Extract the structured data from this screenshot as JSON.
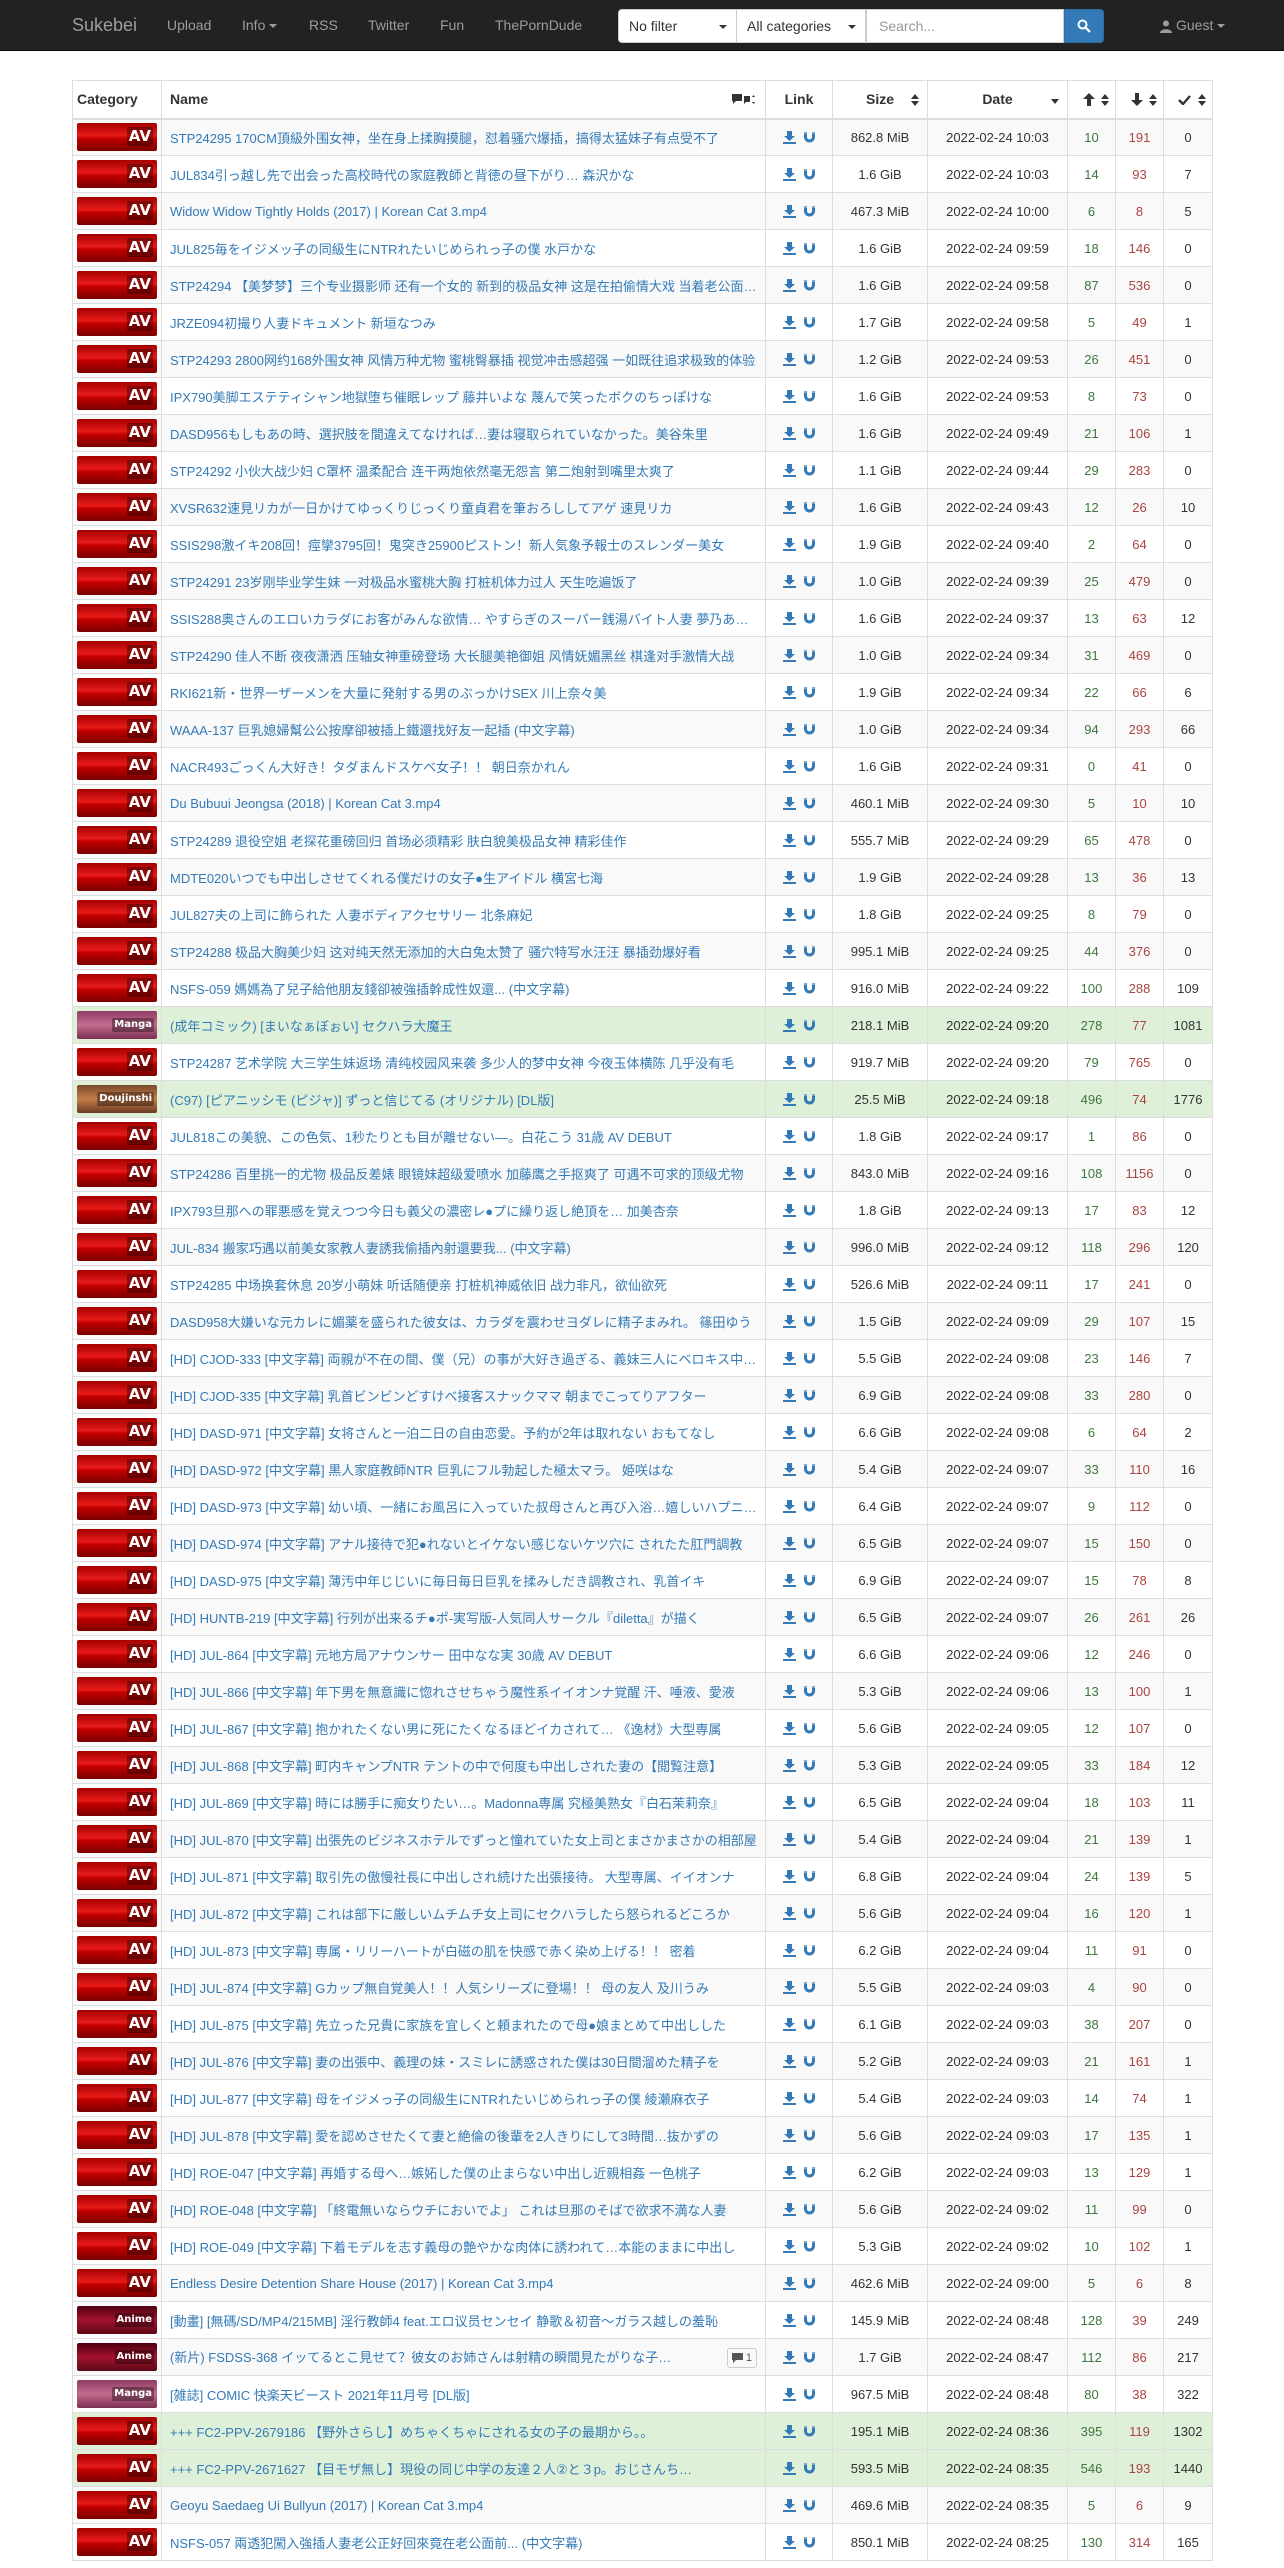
{
  "nav": {
    "brand": "Sukebei",
    "links": [
      "Upload",
      "Info",
      "RSS",
      "Twitter",
      "Fun",
      "ThePornDude"
    ],
    "filter_value": "No filter",
    "category_value": "All categories",
    "search_placeholder": "Search...",
    "user": "Guest"
  },
  "table": {
    "headers": {
      "category": "Category",
      "name": "Name",
      "link": "Link",
      "size": "Size",
      "date": "Date"
    },
    "rows": [
      {
        "cat": "AV",
        "name": "STP24295 170CM頂級外围女神，坐在身上揉胸摸腿，怼着骚穴爆插，搞得太猛妹子有点受不了",
        "size": "862.8 MiB",
        "date": "2022-02-24 10:03",
        "s": "10",
        "l": "191",
        "c": "0"
      },
      {
        "cat": "AV",
        "name": "JUL834引っ越し先で出会った高校時代の家庭教師と背徳の昼下がり… 森沢かな",
        "size": "1.6 GiB",
        "date": "2022-02-24 10:03",
        "s": "14",
        "l": "93",
        "c": "7"
      },
      {
        "cat": "AV",
        "name": "Widow Widow Tightly Holds (2017) | Korean Cat 3.mp4",
        "size": "467.3 MiB",
        "date": "2022-02-24 10:00",
        "s": "6",
        "l": "8",
        "c": "5"
      },
      {
        "cat": "AV",
        "name": "JUL825毎をイジメッ子の同級生にNTRれたいじめられっ子の僕 水戸かな",
        "size": "1.6 GiB",
        "date": "2022-02-24 09:59",
        "s": "18",
        "l": "146",
        "c": "0"
      },
      {
        "cat": "AV",
        "name": "STP24294 【美梦梦】三个专业摄影师 还有一个女的 新到的极品女神 这是在拍偷情大戏 当着老公面被操",
        "size": "1.6 GiB",
        "date": "2022-02-24 09:58",
        "s": "87",
        "l": "536",
        "c": "0"
      },
      {
        "cat": "AV",
        "name": "JRZE094初撮り人妻ドキュメント 新垣なつみ",
        "size": "1.7 GiB",
        "date": "2022-02-24 09:58",
        "s": "5",
        "l": "49",
        "c": "1"
      },
      {
        "cat": "AV",
        "name": "STP24293 2800网约168外围女神 风情万种尤物 蜜桃臀暴插 视觉冲击感超强 一如既往追求极致的体验",
        "size": "1.2 GiB",
        "date": "2022-02-24 09:53",
        "s": "26",
        "l": "451",
        "c": "0"
      },
      {
        "cat": "AV",
        "name": "IPX790美脚エステティシャン地獄堕ち催眠レップ 藤井いよな 蔑んで笑ったボクのちっぽけな",
        "size": "1.6 GiB",
        "date": "2022-02-24 09:53",
        "s": "8",
        "l": "73",
        "c": "0"
      },
      {
        "cat": "AV",
        "name": "DASD956もしもあの時、選択肢を間違えてなければ…妻は寝取られていなかった。美谷朱里",
        "size": "1.6 GiB",
        "date": "2022-02-24 09:49",
        "s": "21",
        "l": "106",
        "c": "1"
      },
      {
        "cat": "AV",
        "name": "STP24292 小伙大战少妇 C罩杯 温柔配合 连干两炮依然毫无怨言 第二炮射到嘴里太爽了",
        "size": "1.1 GiB",
        "date": "2022-02-24 09:44",
        "s": "29",
        "l": "283",
        "c": "0"
      },
      {
        "cat": "AV",
        "name": "XVSR632速見リカが一日かけてゆっくりじっくり童貞君を筆おろししてアゲ 速見リカ",
        "size": "1.6 GiB",
        "date": "2022-02-24 09:43",
        "s": "12",
        "l": "26",
        "c": "10"
      },
      {
        "cat": "AV",
        "name": "SSIS298激イキ208回！痙攣3795回！鬼突き25900ピストン！新人気象予報士のスレンダー美女",
        "size": "1.9 GiB",
        "date": "2022-02-24 09:40",
        "s": "2",
        "l": "64",
        "c": "0"
      },
      {
        "cat": "AV",
        "name": "STP24291 23岁刚毕业学生妹 一对极品水蜜桃大胸 打桩机体力过人 天生吃遍饭了",
        "size": "1.0 GiB",
        "date": "2022-02-24 09:39",
        "s": "25",
        "l": "479",
        "c": "0"
      },
      {
        "cat": "AV",
        "name": "SSIS288奥さんのエロいカラダにお客がみんな欲情… やすらぎのスーパー銭湯バイト人妻 夢乃あいか",
        "size": "1.6 GiB",
        "date": "2022-02-24 09:37",
        "s": "13",
        "l": "63",
        "c": "12"
      },
      {
        "cat": "AV",
        "name": "STP24290 佳人不断 夜夜潇洒 压轴女神重磅登场 大长腿美艳御姐 风情妩媚黑丝 棋逢对手激情大战",
        "size": "1.0 GiB",
        "date": "2022-02-24 09:34",
        "s": "31",
        "l": "469",
        "c": "0"
      },
      {
        "cat": "AV",
        "name": "RKI621新・世界一ザーメンを大量に発射する男のぶっかけSEX 川上奈々美",
        "size": "1.9 GiB",
        "date": "2022-02-24 09:34",
        "s": "22",
        "l": "66",
        "c": "6"
      },
      {
        "cat": "AV",
        "name": "WAAA-137 巨乳媳婦幫公公按摩卻被插上鐵還找好友一起插 (中文字幕)",
        "size": "1.0 GiB",
        "date": "2022-02-24 09:34",
        "s": "94",
        "l": "293",
        "c": "66"
      },
      {
        "cat": "AV",
        "name": "NACR493ごっくん大好き！タダまんドスケベ女子！！ 朝日奈かれん",
        "size": "1.6 GiB",
        "date": "2022-02-24 09:31",
        "s": "0",
        "l": "41",
        "c": "0"
      },
      {
        "cat": "AV",
        "name": "Du Bubuui Jeongsa (2018) | Korean Cat 3.mp4",
        "size": "460.1 MiB",
        "date": "2022-02-24 09:30",
        "s": "5",
        "l": "10",
        "c": "10"
      },
      {
        "cat": "AV",
        "name": "STP24289 退役空姐 老探花重磅回归 首场必须精彩 肤白貌美极品女神 精彩佳作",
        "size": "555.7 MiB",
        "date": "2022-02-24 09:29",
        "s": "65",
        "l": "478",
        "c": "0"
      },
      {
        "cat": "AV",
        "name": "MDTE020いつでも中出しさせてくれる僕だけの女子●生アイドル 横宮七海",
        "size": "1.9 GiB",
        "date": "2022-02-24 09:28",
        "s": "13",
        "l": "36",
        "c": "13"
      },
      {
        "cat": "AV",
        "name": "JUL827夫の上司に飾られた 人妻ボディアクセサリー 北条麻妃",
        "size": "1.8 GiB",
        "date": "2022-02-24 09:25",
        "s": "8",
        "l": "79",
        "c": "0"
      },
      {
        "cat": "AV",
        "name": "STP24288 极品大胸美少妇 这对纯天然无添加的大白兔太赞了 骚穴特写水汪汪 暴插劲爆好看",
        "size": "995.1 MiB",
        "date": "2022-02-24 09:25",
        "s": "44",
        "l": "376",
        "c": "0"
      },
      {
        "cat": "AV",
        "name": "NSFS-059 媽媽為了兒子給他朋友錢卻被強插幹成性奴還... (中文字幕)",
        "size": "916.0 MiB",
        "date": "2022-02-24 09:22",
        "s": "100",
        "l": "288",
        "c": "109"
      },
      {
        "cat": "Manga",
        "name": "(成年コミック) [まいなぁぼぉい] セクハラ大魔王",
        "size": "218.1 MiB",
        "date": "2022-02-24 09:20",
        "s": "278",
        "l": "77",
        "c": "1081",
        "success": true
      },
      {
        "cat": "AV",
        "name": "STP24287 艺术学院 大三学生妹返场 清纯校园风来袭 多少人的梦中女神 今夜玉体横陈 几乎没有毛",
        "size": "919.7 MiB",
        "date": "2022-02-24 09:20",
        "s": "79",
        "l": "765",
        "c": "0"
      },
      {
        "cat": "Doujinshi",
        "name": "(C97) [ピアニッシモ (ピジャ)] ずっと信じてる (オリジナル) [DL版]",
        "size": "25.5 MiB",
        "date": "2022-02-24 09:18",
        "s": "496",
        "l": "74",
        "c": "1776",
        "success": true
      },
      {
        "cat": "AV",
        "name": "JUL818この美貌、この色気、1秒たりとも目が離せない—。白花こう 31歳 AV DEBUT",
        "size": "1.8 GiB",
        "date": "2022-02-24 09:17",
        "s": "1",
        "l": "86",
        "c": "0"
      },
      {
        "cat": "AV",
        "name": "STP24286 百里挑一的尤物 极品反差婊 眼镜妹超级爱喷水 加藤鹰之手抠爽了 可遇不可求的顶级尤物",
        "size": "843.0 MiB",
        "date": "2022-02-24 09:16",
        "s": "108",
        "l": "1156",
        "c": "0"
      },
      {
        "cat": "AV",
        "name": "IPX793旦那への罪悪感を覚えつつ今日も義父の濃密レ●プに繰り返し絶頂を… 加美杏奈",
        "size": "1.8 GiB",
        "date": "2022-02-24 09:13",
        "s": "17",
        "l": "83",
        "c": "12"
      },
      {
        "cat": "AV",
        "name": "JUL-834 搬家巧遇以前美女家教人妻誘我偷插內射還要我... (中文字幕)",
        "size": "996.0 MiB",
        "date": "2022-02-24 09:12",
        "s": "118",
        "l": "296",
        "c": "120"
      },
      {
        "cat": "AV",
        "name": "STP24285 中场换套休息 20岁小萌妹 听话随便亲 打桩机神威依旧 战力非凡，欲仙欲死",
        "size": "526.6 MiB",
        "date": "2022-02-24 09:11",
        "s": "17",
        "l": "241",
        "c": "0"
      },
      {
        "cat": "AV",
        "name": "DASD958大嫌いな元カレに媚薬を盛られた彼女は、カラダを震わせヨダレに精子まみれ。 篠田ゆう",
        "size": "1.5 GiB",
        "date": "2022-02-24 09:09",
        "s": "29",
        "l": "107",
        "c": "15"
      },
      {
        "cat": "AV",
        "name": "[HD] CJOD-333 [中文字幕] 両親が不在の間、僕（兄）の事が大好き過ぎる、義妹三人にベロキス中出し",
        "size": "5.5 GiB",
        "date": "2022-02-24 09:08",
        "s": "23",
        "l": "146",
        "c": "7"
      },
      {
        "cat": "AV",
        "name": "[HD] CJOD-335 [中文字幕] 乳首ビンビンどすけべ接客スナックママ 朝までこってりアフター",
        "size": "6.9 GiB",
        "date": "2022-02-24 09:08",
        "s": "33",
        "l": "280",
        "c": "0"
      },
      {
        "cat": "AV",
        "name": "[HD] DASD-971 [中文字幕] 女将さんと一泊二日の自由恋愛。予約が2年は取れない おもてなし",
        "size": "6.6 GiB",
        "date": "2022-02-24 09:08",
        "s": "6",
        "l": "64",
        "c": "2"
      },
      {
        "cat": "AV",
        "name": "[HD] DASD-972 [中文字幕] 黒人家庭教師NTR 巨乳にフル勃起した極太マラ。 姫咲はな",
        "size": "5.4 GiB",
        "date": "2022-02-24 09:07",
        "s": "33",
        "l": "110",
        "c": "16"
      },
      {
        "cat": "AV",
        "name": "[HD] DASD-973 [中文字幕] 幼い頃、一緒にお風呂に入っていた叔母さんと再び入浴…嬉しいハプニング",
        "size": "6.4 GiB",
        "date": "2022-02-24 09:07",
        "s": "9",
        "l": "112",
        "c": "0"
      },
      {
        "cat": "AV",
        "name": "[HD] DASD-974 [中文字幕] アナル接待で犯●れないとイケない感じないケツ穴に されたた肛門調教",
        "size": "6.5 GiB",
        "date": "2022-02-24 09:07",
        "s": "15",
        "l": "150",
        "c": "0"
      },
      {
        "cat": "AV",
        "name": "[HD] DASD-975 [中文字幕] 薄汚中年じじいに毎日毎日巨乳を揉みしだき調教され、乳首イキ",
        "size": "6.9 GiB",
        "date": "2022-02-24 09:07",
        "s": "15",
        "l": "78",
        "c": "8"
      },
      {
        "cat": "AV",
        "name": "[HD] HUNTB-219 [中文字幕] 行列が出来るチ●ポ-実写版-人気同人サークル『diletta』が描く",
        "size": "6.5 GiB",
        "date": "2022-02-24 09:07",
        "s": "26",
        "l": "261",
        "c": "26"
      },
      {
        "cat": "AV",
        "name": "[HD] JUL-864 [中文字幕] 元地方局アナウンサー 田中なな実 30歳 AV DEBUT",
        "size": "6.6 GiB",
        "date": "2022-02-24 09:06",
        "s": "12",
        "l": "246",
        "c": "0"
      },
      {
        "cat": "AV",
        "name": "[HD] JUL-866 [中文字幕] 年下男を無意識に惚れさせちゃう魔性系イイオンナ覚醒 汗、唾液、愛液",
        "size": "5.3 GiB",
        "date": "2022-02-24 09:06",
        "s": "13",
        "l": "100",
        "c": "1"
      },
      {
        "cat": "AV",
        "name": "[HD] JUL-867 [中文字幕] 抱かれたくない男に死にたくなるほどイカされて… 《逸材》大型専属",
        "size": "5.6 GiB",
        "date": "2022-02-24 09:05",
        "s": "12",
        "l": "107",
        "c": "0"
      },
      {
        "cat": "AV",
        "name": "[HD] JUL-868 [中文字幕] 町内キャンプNTR テントの中で何度も中出しされた妻の【閲覧注意】",
        "size": "5.3 GiB",
        "date": "2022-02-24 09:05",
        "s": "33",
        "l": "184",
        "c": "12"
      },
      {
        "cat": "AV",
        "name": "[HD] JUL-869 [中文字幕] 時には勝手に痴女りたい…。Madonna専属 究極美熟女『白石茉莉奈』",
        "size": "6.5 GiB",
        "date": "2022-02-24 09:04",
        "s": "18",
        "l": "103",
        "c": "11"
      },
      {
        "cat": "AV",
        "name": "[HD] JUL-870 [中文字幕] 出張先のビジネスホテルでずっと憧れていた女上司とまさかまさかの相部屋",
        "size": "5.4 GiB",
        "date": "2022-02-24 09:04",
        "s": "21",
        "l": "139",
        "c": "1"
      },
      {
        "cat": "AV",
        "name": "[HD] JUL-871 [中文字幕] 取引先の傲慢社長に中出しされ続けた出張接待。 大型専属、イイオンナ",
        "size": "6.8 GiB",
        "date": "2022-02-24 09:04",
        "s": "24",
        "l": "139",
        "c": "5"
      },
      {
        "cat": "AV",
        "name": "[HD] JUL-872 [中文字幕] これは部下に厳しいムチムチ女上司にセクハラしたら怒られるどころか",
        "size": "5.6 GiB",
        "date": "2022-02-24 09:04",
        "s": "16",
        "l": "120",
        "c": "1"
      },
      {
        "cat": "AV",
        "name": "[HD] JUL-873 [中文字幕] 専属・リリーハートが白磁の肌を快感で赤く染め上げる！！ 密着",
        "size": "6.2 GiB",
        "date": "2022-02-24 09:04",
        "s": "11",
        "l": "91",
        "c": "0"
      },
      {
        "cat": "AV",
        "name": "[HD] JUL-874 [中文字幕] Gカップ無自覚美人！！人気シリーズに登場！！ 母の友人 及川うみ",
        "size": "5.5 GiB",
        "date": "2022-02-24 09:03",
        "s": "4",
        "l": "90",
        "c": "0"
      },
      {
        "cat": "AV",
        "name": "[HD] JUL-875 [中文字幕] 先立った兄貴に家族を宜しくと頼まれたので母●娘まとめて中出しした",
        "size": "6.1 GiB",
        "date": "2022-02-24 09:03",
        "s": "38",
        "l": "207",
        "c": "0"
      },
      {
        "cat": "AV",
        "name": "[HD] JUL-876 [中文字幕] 妻の出張中、義理の妹・スミレに誘惑された僕は30日間溜めた精子を",
        "size": "5.2 GiB",
        "date": "2022-02-24 09:03",
        "s": "21",
        "l": "161",
        "c": "1"
      },
      {
        "cat": "AV",
        "name": "[HD] JUL-877 [中文字幕] 母をイジメっ子の同級生にNTRれたいじめられっ子の僕 綾瀬麻衣子",
        "size": "5.4 GiB",
        "date": "2022-02-24 09:03",
        "s": "14",
        "l": "74",
        "c": "1"
      },
      {
        "cat": "AV",
        "name": "[HD] JUL-878 [中文字幕] 愛を認めさせたくて妻と絶倫の後輩を2人きりにして3時間…抜かずの",
        "size": "5.6 GiB",
        "date": "2022-02-24 09:03",
        "s": "17",
        "l": "135",
        "c": "1"
      },
      {
        "cat": "AV",
        "name": "[HD] ROE-047 [中文字幕] 再婚する母へ…嫉妬した僕の止まらない中出し近親相姦 一色桃子",
        "size": "6.2 GiB",
        "date": "2022-02-24 09:03",
        "s": "13",
        "l": "129",
        "c": "1"
      },
      {
        "cat": "AV",
        "name": "[HD] ROE-048 [中文字幕] 「終電無いならウチにおいでよ」 これは旦那のそばで欲求不満な人妻",
        "size": "5.6 GiB",
        "date": "2022-02-24 09:02",
        "s": "11",
        "l": "99",
        "c": "0"
      },
      {
        "cat": "AV",
        "name": "[HD] ROE-049 [中文字幕] 下着モデルを志す義母の艶やかな肉体に誘われて…本能のままに中出し",
        "size": "5.3 GiB",
        "date": "2022-02-24 09:02",
        "s": "10",
        "l": "102",
        "c": "1"
      },
      {
        "cat": "AV",
        "name": "Endless Desire Detention Share House (2017) | Korean Cat 3.mp4",
        "size": "462.6 MiB",
        "date": "2022-02-24 09:00",
        "s": "5",
        "l": "6",
        "c": "8"
      },
      {
        "cat": "Anime",
        "name": "[動畫] [無碼/SD/MP4/215MB] 淫行教師4 feat.エロ议员センセイ 静歌＆初音～ガラス越しの羞恥",
        "size": "145.9 MiB",
        "date": "2022-02-24 08:48",
        "s": "128",
        "l": "39",
        "c": "249"
      },
      {
        "cat": "Anime",
        "name": "(新片) FSDSS-368 イッてるとこ見せて？彼女のお姉さんは射精の瞬間見たがりな子…",
        "size": "1.7 GiB",
        "date": "2022-02-24 08:47",
        "s": "112",
        "l": "86",
        "c": "217",
        "comments": "1"
      },
      {
        "cat": "Manga",
        "name": "[雑誌] COMIC 快楽天ビースト 2021年11月号 [DL版]",
        "size": "967.5 MiB",
        "date": "2022-02-24 08:48",
        "s": "80",
        "l": "38",
        "c": "322"
      },
      {
        "cat": "AV",
        "name": "+++ FC2-PPV-2679186 【野外さらし】めちゃくちゃにされる女の子の最期から。。",
        "size": "195.1 MiB",
        "date": "2022-02-24 08:36",
        "s": "395",
        "l": "119",
        "c": "1302",
        "success": true
      },
      {
        "cat": "AV",
        "name": "+++ FC2-PPV-2671627 【目モザ無し】現役の同じ中学の友達２人②と３p。おじさんち…",
        "size": "593.5 MiB",
        "date": "2022-02-24 08:35",
        "s": "546",
        "l": "193",
        "c": "1440",
        "success": true
      },
      {
        "cat": "AV",
        "name": "Geoyu Saedaeg Ui Bullyun (2017) | Korean Cat 3.mp4",
        "size": "469.6 MiB",
        "date": "2022-02-24 08:35",
        "s": "5",
        "l": "6",
        "c": "9"
      },
      {
        "cat": "AV",
        "name": "NSFS-057 兩透犯闖入強插人妻老公正好回來竟在老公面前... (中文字幕)",
        "size": "850.1 MiB",
        "date": "2022-02-24 08:25",
        "s": "130",
        "l": "314",
        "c": "165"
      }
    ]
  }
}
